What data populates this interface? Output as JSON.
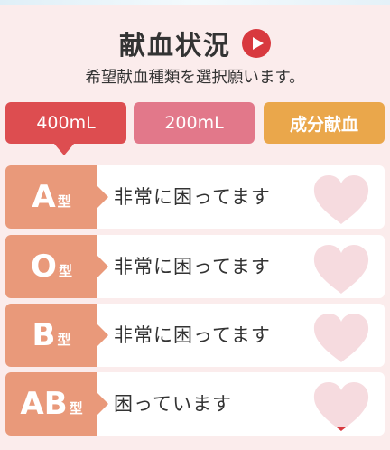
{
  "header": {
    "title": "献血状況",
    "subtitle": "希望献血種類を選択願います。"
  },
  "tabs": [
    {
      "label": "400mL",
      "selected": true
    },
    {
      "label": "200mL",
      "selected": false
    },
    {
      "label": "成分献血",
      "selected": false
    }
  ],
  "blood_types": [
    {
      "letter": "A",
      "suffix": "型",
      "status": "非常に困ってます",
      "level": 0
    },
    {
      "letter": "O",
      "suffix": "型",
      "status": "非常に困ってます",
      "level": 0
    },
    {
      "letter": "B",
      "suffix": "型",
      "status": "非常に困ってます",
      "level": 0
    },
    {
      "letter": "AB",
      "suffix": "型",
      "status": "困っています",
      "level": 0.12
    }
  ],
  "colors": {
    "accent_red": "#dd4d50",
    "tab_pink": "#e2788a",
    "tab_orange": "#eaa74b",
    "type_label": "#e9997a",
    "heart_empty": "#f6dbdf",
    "heart_fill": "#d8393f"
  },
  "icons": {
    "play": "play-icon",
    "heart": "heart-icon"
  }
}
